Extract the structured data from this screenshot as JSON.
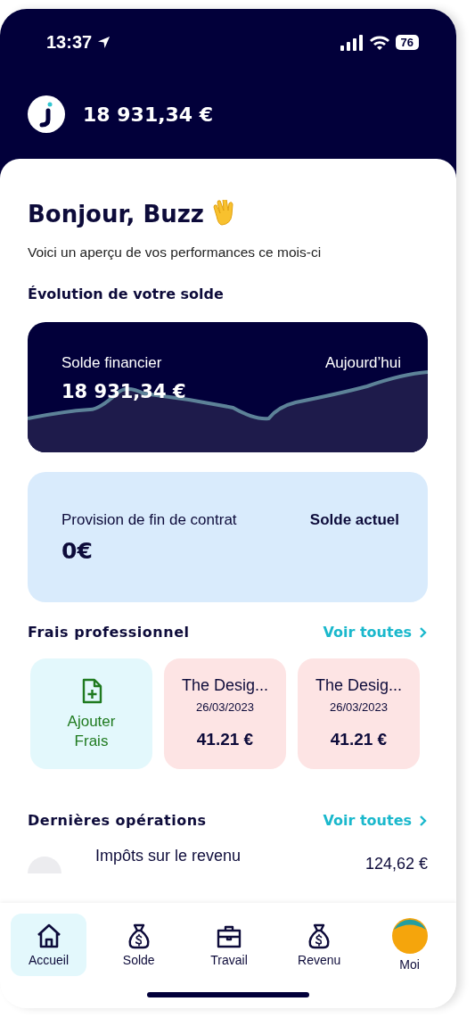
{
  "status_bar": {
    "time": "13:37",
    "battery": "76"
  },
  "header": {
    "balance": "18 931,34 €"
  },
  "greeting": {
    "title": "Bonjour, Buzz",
    "subtitle": "Voici un aperçu de vos performances ce mois-ci"
  },
  "balance_section": {
    "title": "Évolution de votre solde",
    "card": {
      "label": "Solde financier",
      "amount": "18 931,34 €",
      "period": "Aujourd’hui"
    }
  },
  "provision_card": {
    "label": "Provision de fin de contrat",
    "amount": "0€",
    "status": "Solde actuel"
  },
  "expenses": {
    "title": "Frais professionnel",
    "link": "Voir toutes",
    "tiles": [
      {
        "kind": "add",
        "label": "Ajouter Frais"
      },
      {
        "kind": "expense",
        "name": "The Desig...",
        "date": "26/03/2023",
        "amount": "41.21 €"
      },
      {
        "kind": "expense",
        "name": "The Desig...",
        "date": "26/03/2023",
        "amount": "41.21 €"
      }
    ]
  },
  "operations": {
    "title": "Dernières opérations",
    "link": "Voir toutes",
    "rows": [
      {
        "name": "Impôts sur le revenu",
        "amount": "124,62 €"
      }
    ]
  },
  "tab_bar": [
    {
      "label": "Accueil",
      "kind": "home",
      "selected": true
    },
    {
      "label": "Solde",
      "kind": "money",
      "selected": false
    },
    {
      "label": "Travail",
      "kind": "briefcase",
      "selected": false
    },
    {
      "label": "Revenu",
      "kind": "money",
      "selected": false
    },
    {
      "label": "Moi",
      "kind": "avatar",
      "selected": false
    }
  ]
}
